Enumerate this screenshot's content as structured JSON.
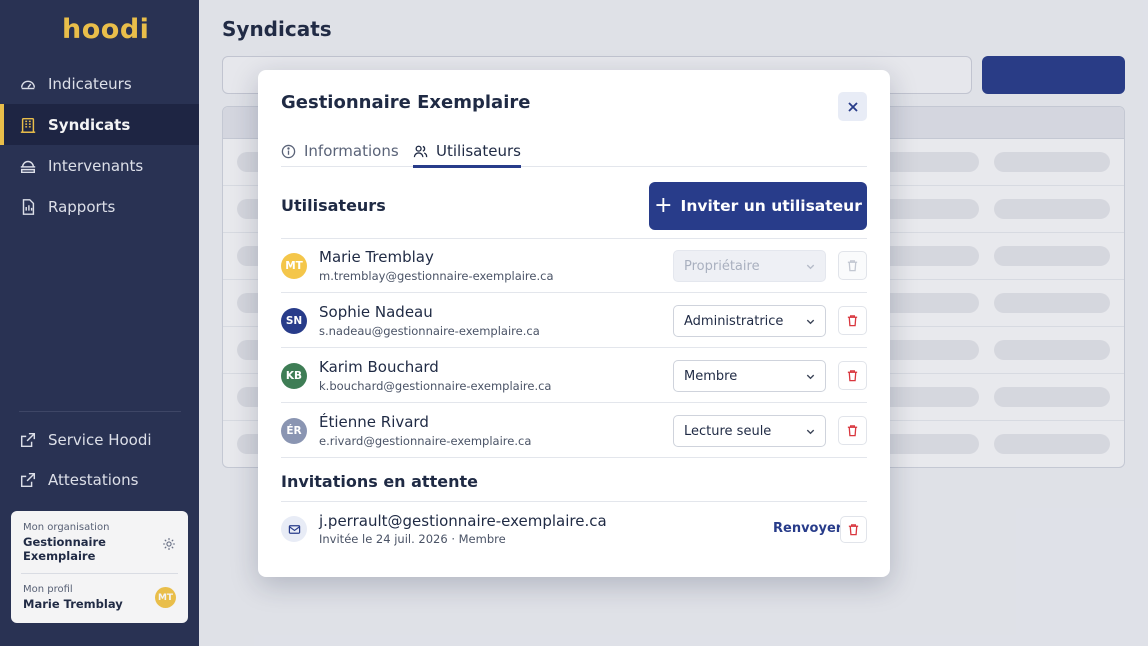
{
  "app": {
    "logo": "hoodi"
  },
  "sidebar": {
    "items": [
      {
        "label": "Indicateurs",
        "icon": "gauge-icon"
      },
      {
        "label": "Syndicats",
        "icon": "building-icon"
      },
      {
        "label": "Intervenants",
        "icon": "worker-icon"
      },
      {
        "label": "Rapports",
        "icon": "report-icon"
      }
    ],
    "links": [
      {
        "label": "Service Hoodi",
        "icon": "external-link-icon"
      },
      {
        "label": "Attestations",
        "icon": "external-link-icon"
      }
    ],
    "org_card": {
      "org_caption": "Mon organisation",
      "org_name_line1": "Gestionnaire",
      "org_name_line2": "Exemplaire",
      "profile_caption": "Mon profil",
      "profile_name": "Marie Tremblay",
      "profile_initials": "MT"
    }
  },
  "page": {
    "title": "Syndicats"
  },
  "modal": {
    "title": "Gestionnaire Exemplaire",
    "tabs": [
      {
        "label": "Informations",
        "active": false
      },
      {
        "label": "Utilisateurs",
        "active": true
      }
    ],
    "users_section": {
      "title": "Utilisateurs",
      "invite_button": "Inviter un utilisateur",
      "users": [
        {
          "initials": "MT",
          "name": "Marie Tremblay",
          "email": "m.tremblay@gestionnaire-exemplaire.ca",
          "role": "Propriétaire",
          "avatar_color": "#f4c64a",
          "disabled": true
        },
        {
          "initials": "SN",
          "name": "Sophie Nadeau",
          "email": "s.nadeau@gestionnaire-exemplaire.ca",
          "role": "Administratrice",
          "avatar_color": "#283c8a",
          "disabled": false
        },
        {
          "initials": "KB",
          "name": "Karim Bouchard",
          "email": "k.bouchard@gestionnaire-exemplaire.ca",
          "role": "Membre",
          "avatar_color": "#3e7d55",
          "disabled": false
        },
        {
          "initials": "ÉR",
          "name": "Étienne Rivard",
          "email": "e.rivard@gestionnaire-exemplaire.ca",
          "role": "Lecture seule",
          "avatar_color": "#8a95b2",
          "disabled": false
        }
      ]
    },
    "pending_section": {
      "title": "Invitations en attente",
      "invitations": [
        {
          "email": "j.perrault@gestionnaire-exemplaire.ca",
          "meta": "Invitée le 24 juil. 2026 · Membre",
          "resend_label": "Renvoyer"
        }
      ]
    }
  },
  "colors": {
    "sidebar_bg": "#283153",
    "accent_yellow": "#f4c64a",
    "primary_blue": "#283c8a",
    "danger_red": "#d9363e"
  }
}
